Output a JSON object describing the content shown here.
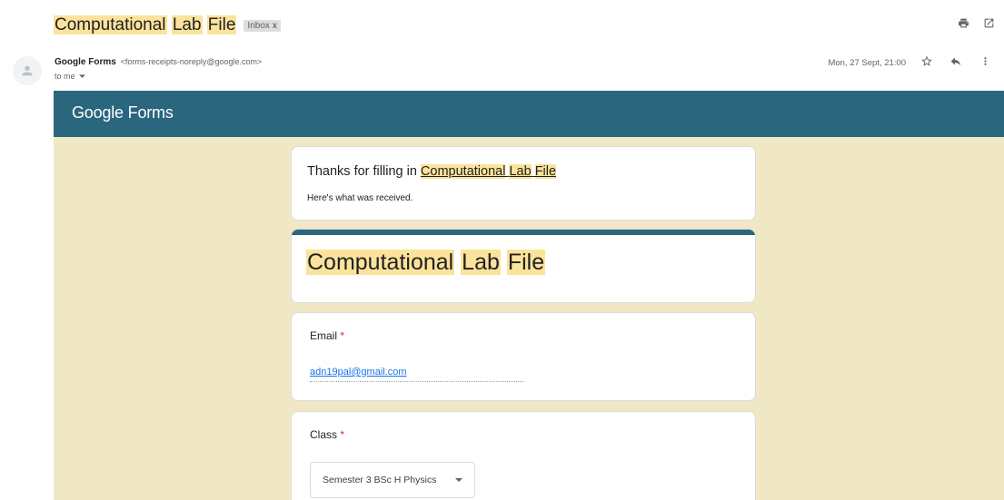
{
  "subject": {
    "words": [
      "Computational",
      "Lab",
      "File"
    ],
    "label_badge": "Inbox",
    "label_badge_close": "x"
  },
  "toolbar": {
    "print_icon": "print-icon",
    "popout_icon": "open-in-new-window-icon"
  },
  "message": {
    "sender_name": "Google Forms",
    "sender_email": "<forms-receipts-noreply@google.com>",
    "recipient": "to me",
    "date": "Mon, 27 Sept, 21:00",
    "icons": [
      "avatar-icon",
      "star-icon",
      "reply-icon",
      "more-vert-icon",
      "chevron-down-icon"
    ]
  },
  "email_body": {
    "brand": "Google Forms",
    "thanks_prefix": "Thanks for filling in ",
    "thanks_link_words": [
      "Computational",
      "Lab",
      "File"
    ],
    "received_text": "Here's what was received.",
    "form_title_words": [
      "Computational",
      "Lab",
      "File"
    ],
    "questions": [
      {
        "label": "Email",
        "required_mark": "*",
        "answer": "adn19pal@gmail.com"
      },
      {
        "label": "Class",
        "required_mark": "*",
        "answer": "Semester 3 BSc H Physics"
      }
    ]
  },
  "colors": {
    "brand_teal": "#2a667e",
    "canvas_beige": "#f0e8c4",
    "highlight": "#fce39b",
    "required_red": "#d93025",
    "link_blue": "#1a73e8"
  }
}
